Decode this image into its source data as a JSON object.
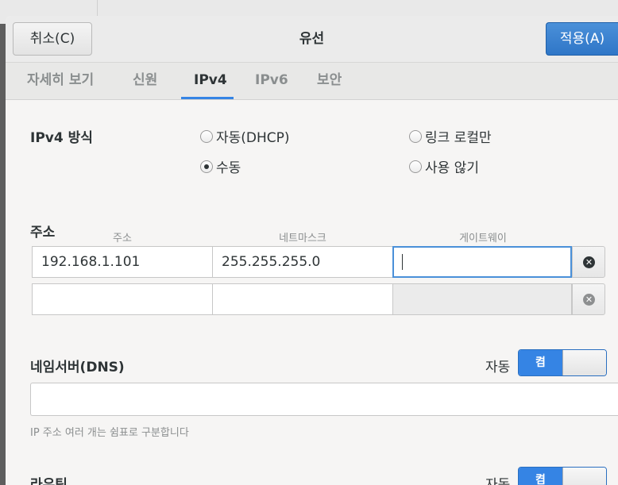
{
  "header": {
    "cancel_label": "취소(C)",
    "title": "유선",
    "apply_label": "적용(A)"
  },
  "tabs": [
    {
      "label": "자세히 보기",
      "active": false
    },
    {
      "label": "신원",
      "active": false
    },
    {
      "label": "IPv4",
      "active": true
    },
    {
      "label": "IPv6",
      "active": false
    },
    {
      "label": "보안",
      "active": false
    }
  ],
  "method": {
    "label": "IPv4 방식",
    "options": [
      {
        "label": "자동(DHCP)",
        "checked": false
      },
      {
        "label": "링크 로컬만",
        "checked": false
      },
      {
        "label": "수동",
        "checked": true
      },
      {
        "label": "사용 않기",
        "checked": false
      }
    ]
  },
  "addresses": {
    "label": "주소",
    "columns": [
      "주소",
      "네트마스크",
      "게이트웨이"
    ],
    "rows": [
      {
        "address": "192.168.1.101",
        "netmask": "255.255.255.0",
        "gateway": ""
      },
      {
        "address": "",
        "netmask": "",
        "gateway": ""
      }
    ]
  },
  "dns": {
    "label": "네임서버(DNS)",
    "auto_label": "자동",
    "switch_label": "켬",
    "value": "",
    "hint": "IP 주소 여러 개는 쉼표로 구분합니다"
  },
  "routes": {
    "label": "라우팅",
    "auto_label": "자동",
    "switch_label": "켬"
  },
  "colors": {
    "accent": "#3584e4",
    "apply_button": "#3b82d0",
    "focus_border": "#4a90d9"
  },
  "icons": {
    "remove": "circle-x-icon"
  }
}
